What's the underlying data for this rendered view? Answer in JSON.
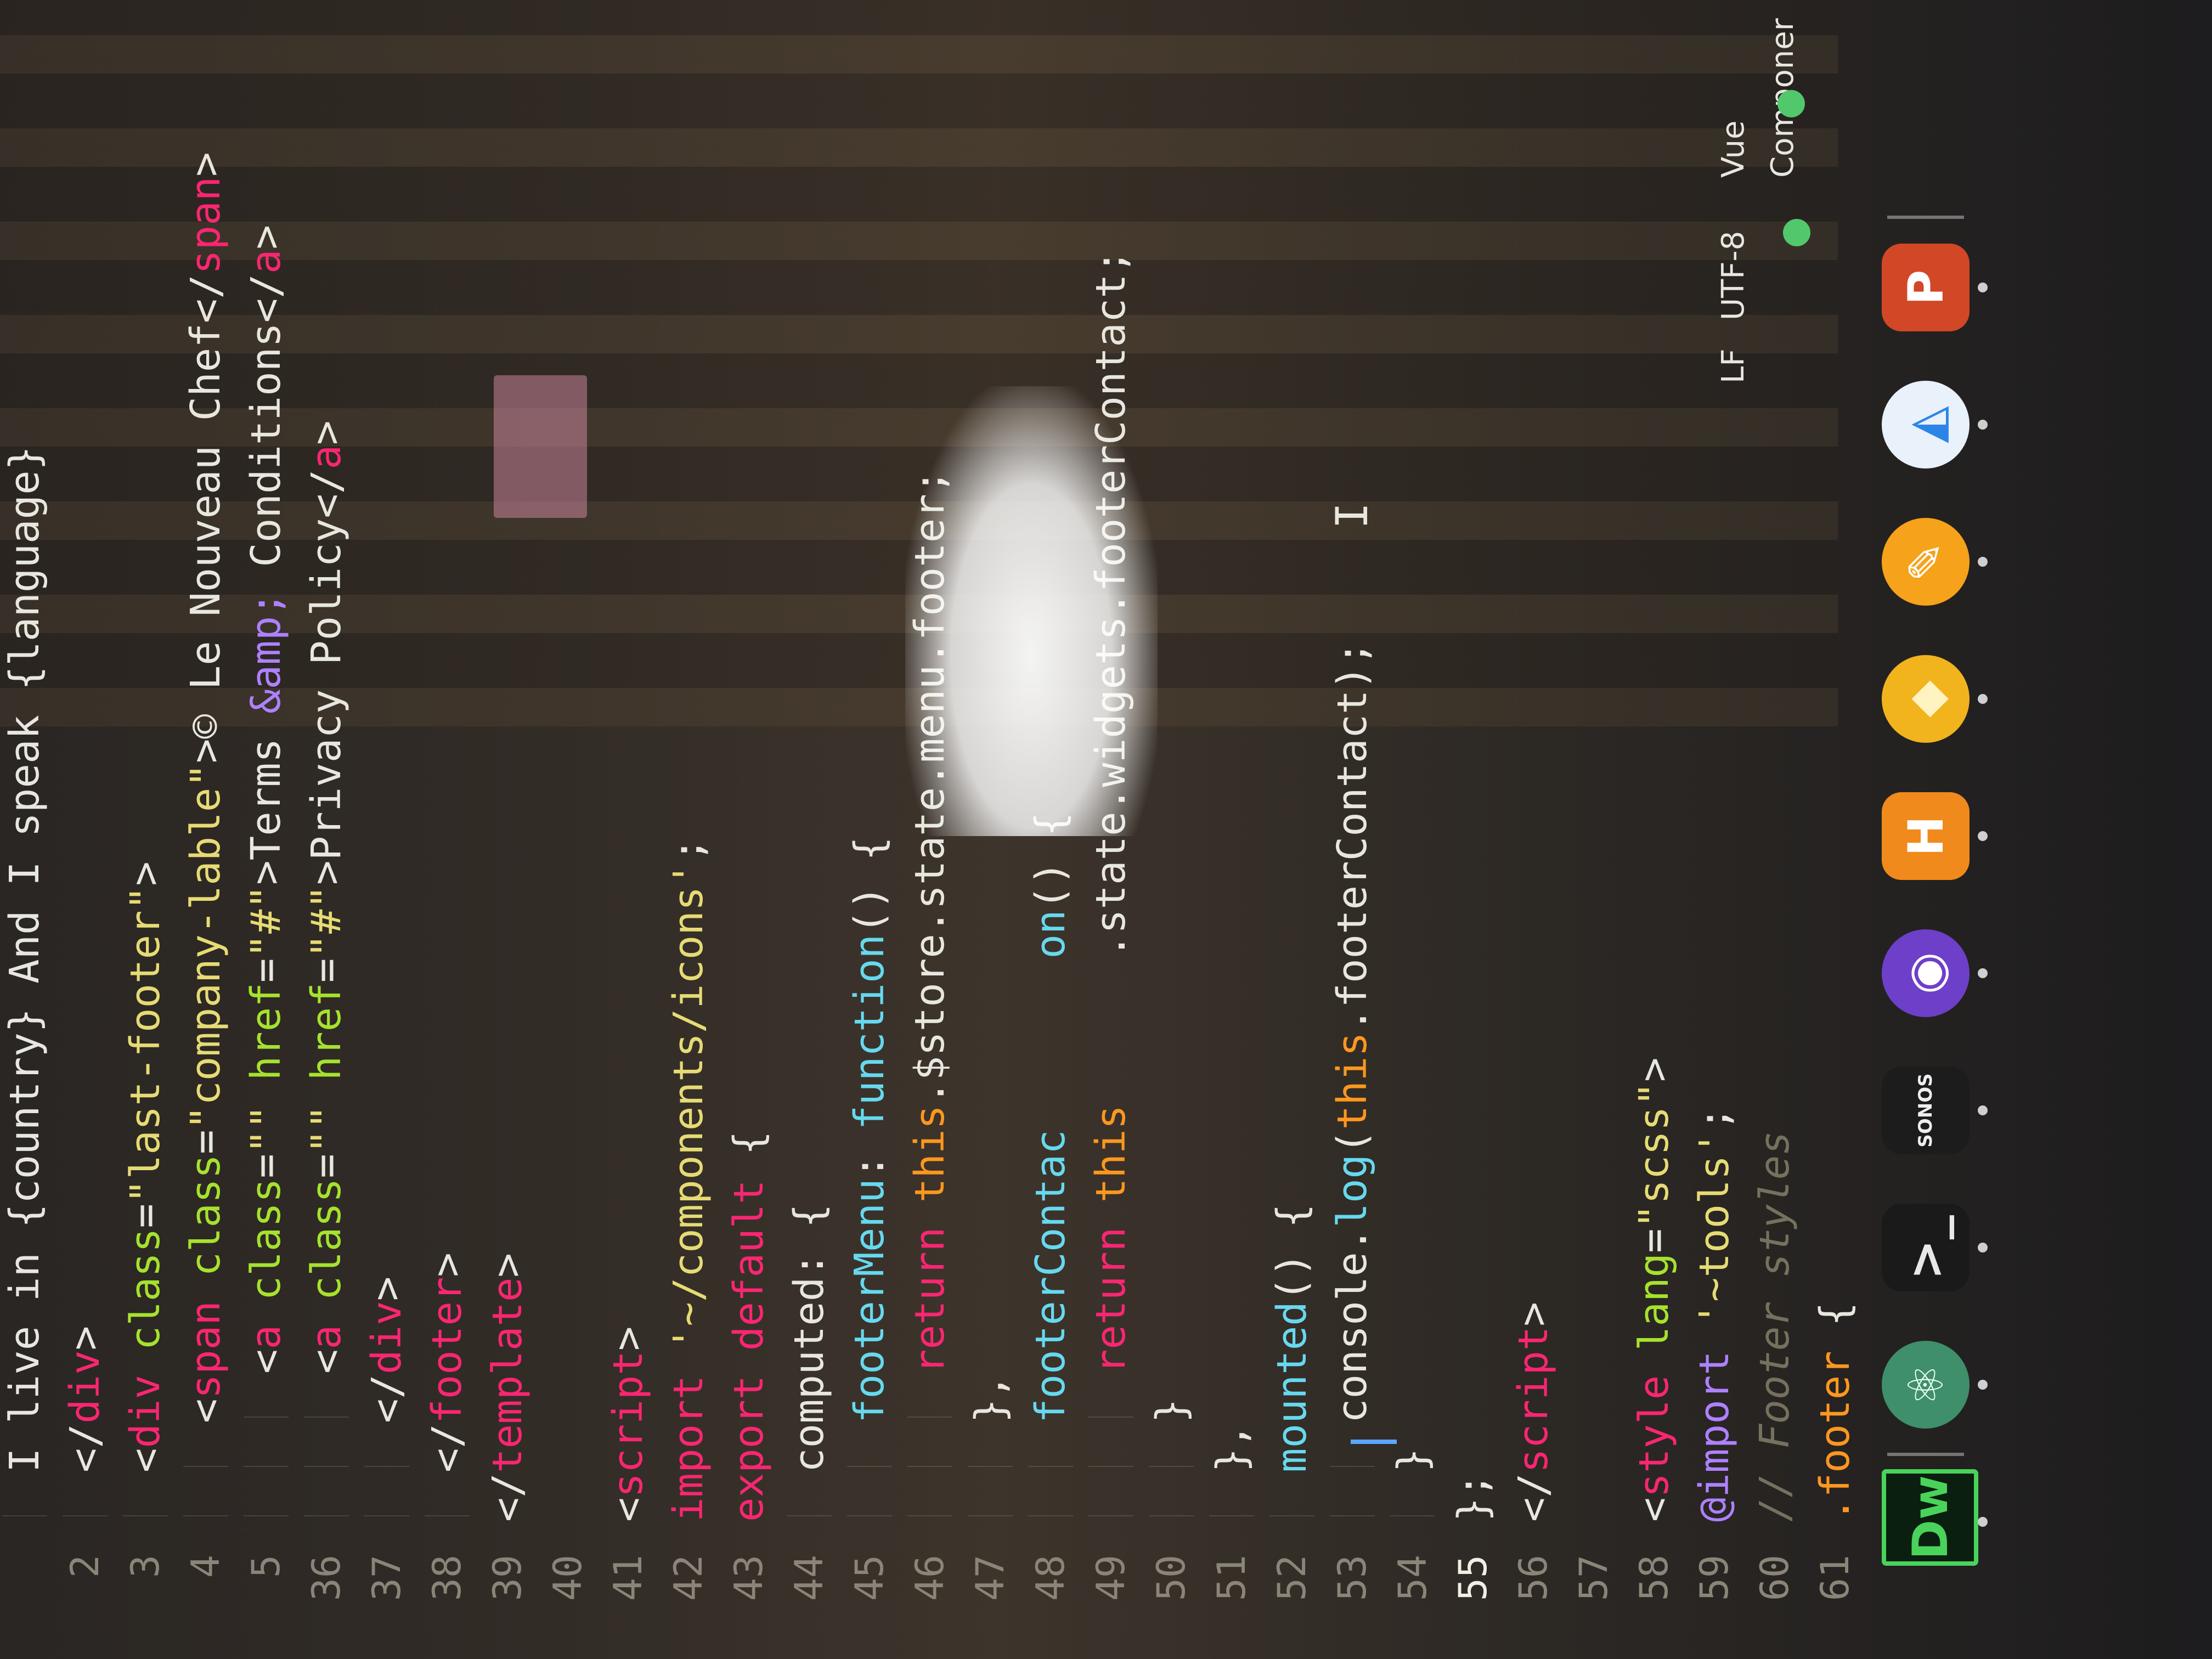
{
  "editor": {
    "lines": [
      {
        "n": "",
        "tokens": [
          {
            "t": "I live in {country} And I speak {language}",
            "c": "plain"
          }
        ]
      },
      {
        "n": "2",
        "tokens": [
          {
            "t": "</",
            "c": "punc"
          },
          {
            "t": "div",
            "c": "tag"
          },
          {
            "t": ">",
            "c": "punc"
          }
        ]
      },
      {
        "n": "3",
        "tokens": [
          {
            "t": "<",
            "c": "punc"
          },
          {
            "t": "div",
            "c": "tag"
          },
          {
            "t": " class",
            "c": "attr"
          },
          {
            "t": "=",
            "c": "punc"
          },
          {
            "t": "\"last-footer\"",
            "c": "str"
          },
          {
            "t": ">",
            "c": "punc"
          }
        ]
      },
      {
        "n": "4",
        "tokens": [
          {
            "t": "<",
            "c": "punc"
          },
          {
            "t": "span",
            "c": "tag"
          },
          {
            "t": " class",
            "c": "attr"
          },
          {
            "t": "=",
            "c": "punc"
          },
          {
            "t": "\"company-lable\"",
            "c": "str"
          },
          {
            "t": ">© Le Nouveau Chef</",
            "c": "plain"
          },
          {
            "t": "span",
            "c": "tag"
          },
          {
            "t": ">",
            "c": "punc"
          }
        ]
      },
      {
        "n": "5",
        "tokens": [
          {
            "t": "<",
            "c": "punc"
          },
          {
            "t": "a",
            "c": "tag"
          },
          {
            "t": " class",
            "c": "attr"
          },
          {
            "t": "=",
            "c": "punc"
          },
          {
            "t": "\"\"",
            "c": "str"
          },
          {
            "t": " href",
            "c": "attr"
          },
          {
            "t": "=",
            "c": "punc"
          },
          {
            "t": "\"#\"",
            "c": "str"
          },
          {
            "t": ">Terms ",
            "c": "plain"
          },
          {
            "t": "&amp;",
            "c": "at"
          },
          {
            "t": " Conditions</",
            "c": "plain"
          },
          {
            "t": "a",
            "c": "tag"
          },
          {
            "t": ">",
            "c": "punc"
          }
        ]
      },
      {
        "n": "36",
        "tokens": [
          {
            "t": "<",
            "c": "punc"
          },
          {
            "t": "a",
            "c": "tag"
          },
          {
            "t": " class",
            "c": "attr"
          },
          {
            "t": "=",
            "c": "punc"
          },
          {
            "t": "\"\"",
            "c": "str"
          },
          {
            "t": " href",
            "c": "attr"
          },
          {
            "t": "=",
            "c": "punc"
          },
          {
            "t": "\"#\"",
            "c": "str"
          },
          {
            "t": ">Privacy Policy</",
            "c": "plain"
          },
          {
            "t": "a",
            "c": "tag"
          },
          {
            "t": ">",
            "c": "punc"
          }
        ]
      },
      {
        "n": "37",
        "tokens": [
          {
            "t": "</",
            "c": "punc"
          },
          {
            "t": "div",
            "c": "tag"
          },
          {
            "t": ">",
            "c": "punc"
          }
        ]
      },
      {
        "n": "38",
        "tokens": [
          {
            "t": "</",
            "c": "punc"
          },
          {
            "t": "footer",
            "c": "tag"
          },
          {
            "t": ">",
            "c": "punc"
          }
        ]
      },
      {
        "n": "39",
        "tokens": [
          {
            "t": "</",
            "c": "punc"
          },
          {
            "t": "template",
            "c": "tag"
          },
          {
            "t": ">",
            "c": "punc"
          }
        ]
      },
      {
        "n": "40",
        "tokens": []
      },
      {
        "n": "41",
        "tokens": [
          {
            "t": "<",
            "c": "punc"
          },
          {
            "t": "script",
            "c": "tag"
          },
          {
            "t": ">",
            "c": "punc"
          }
        ]
      },
      {
        "n": "42",
        "tokens": [
          {
            "t": "import",
            "c": "kw"
          },
          {
            "t": " ",
            "c": "plain"
          },
          {
            "t": "'~/components/icons'",
            "c": "str"
          },
          {
            "t": ";",
            "c": "plain"
          }
        ]
      },
      {
        "n": "43",
        "tokens": [
          {
            "t": "export",
            "c": "kw"
          },
          {
            "t": " ",
            "c": "plain"
          },
          {
            "t": "default",
            "c": "kw"
          },
          {
            "t": " {",
            "c": "plain"
          }
        ]
      },
      {
        "n": "44",
        "tokens": [
          {
            "t": "computed: {",
            "c": "plain"
          }
        ]
      },
      {
        "n": "45",
        "tokens": [
          {
            "t": "footerMenu",
            "c": "fn"
          },
          {
            "t": ": ",
            "c": "plain"
          },
          {
            "t": "function",
            "c": "fn"
          },
          {
            "t": "() {",
            "c": "plain"
          }
        ]
      },
      {
        "n": "46",
        "tokens": [
          {
            "t": "return",
            "c": "kw"
          },
          {
            "t": " ",
            "c": "plain"
          },
          {
            "t": "this",
            "c": "this"
          },
          {
            "t": ".$store.state.menu.footer;",
            "c": "plain"
          }
        ]
      },
      {
        "n": "47",
        "tokens": [
          {
            "t": "},",
            "c": "plain"
          }
        ]
      },
      {
        "n": "48",
        "tokens": [
          {
            "t": "footerContac",
            "c": "fn"
          },
          {
            "t": "       ",
            "c": "plain"
          },
          {
            "t": "on",
            "c": "fn"
          },
          {
            "t": "() {",
            "c": "plain"
          }
        ]
      },
      {
        "n": "49",
        "tokens": [
          {
            "t": "return",
            "c": "kw"
          },
          {
            "t": " ",
            "c": "plain"
          },
          {
            "t": "this",
            "c": "this"
          },
          {
            "t": "      .state.widgets.footerContact;",
            "c": "plain"
          }
        ]
      },
      {
        "n": "50",
        "tokens": [
          {
            "t": "}",
            "c": "plain"
          }
        ]
      },
      {
        "n": "51",
        "tokens": [
          {
            "t": "},",
            "c": "plain"
          }
        ]
      },
      {
        "n": "52",
        "tokens": [
          {
            "t": "mounted",
            "c": "fn"
          },
          {
            "t": "() {",
            "c": "plain"
          }
        ]
      },
      {
        "n": "53",
        "tokens": [
          {
            "t": "console",
            "c": "plain"
          },
          {
            "t": ".",
            "c": "plain"
          },
          {
            "t": "log",
            "c": "fn"
          },
          {
            "t": "(",
            "c": "plain"
          },
          {
            "t": "this",
            "c": "this"
          },
          {
            "t": ".footerContact);",
            "c": "plain"
          }
        ]
      },
      {
        "n": "54",
        "tokens": [
          {
            "t": "}",
            "c": "plain"
          }
        ]
      },
      {
        "n": "55",
        "tokens": [
          {
            "t": "};",
            "c": "plain"
          }
        ],
        "active": true
      },
      {
        "n": "56",
        "tokens": [
          {
            "t": "</",
            "c": "punc"
          },
          {
            "t": "script",
            "c": "tag"
          },
          {
            "t": ">",
            "c": "punc"
          }
        ]
      },
      {
        "n": "57",
        "tokens": []
      },
      {
        "n": "58",
        "tokens": [
          {
            "t": "<",
            "c": "punc"
          },
          {
            "t": "style",
            "c": "tag"
          },
          {
            "t": " lang",
            "c": "attr"
          },
          {
            "t": "=",
            "c": "punc"
          },
          {
            "t": "\"scss\"",
            "c": "str"
          },
          {
            "t": ">",
            "c": "punc"
          }
        ]
      },
      {
        "n": "59",
        "tokens": [
          {
            "t": "@import",
            "c": "at"
          },
          {
            "t": " ",
            "c": "plain"
          },
          {
            "t": "'~tools'",
            "c": "str"
          },
          {
            "t": ";",
            "c": "plain"
          }
        ]
      },
      {
        "n": "60",
        "tokens": [
          {
            "t": "// Footer styles",
            "c": "com"
          }
        ]
      },
      {
        "n": "61",
        "tokens": [
          {
            "t": ".footer",
            "c": "prop"
          },
          {
            "t": " {",
            "c": "plain"
          }
        ]
      }
    ],
    "indents": [
      1,
      1,
      1,
      2,
      3,
      3,
      2,
      1,
      0,
      0,
      0,
      0,
      0,
      1,
      2,
      3,
      2,
      2,
      3,
      2,
      1,
      1,
      2,
      1,
      0,
      0,
      0,
      0,
      0,
      0,
      0
    ]
  },
  "statusbar": {
    "line_ending": "LF",
    "encoding": "UTF-8",
    "grammar": "Vue Componer"
  },
  "dock": {
    "apps": [
      {
        "name": "dreamweaver",
        "label": "Dw",
        "bg": "#0a1f0f",
        "fg": "#49d35a"
      },
      {
        "name": "atom",
        "label": "⚛",
        "bg": "#3f8f6a",
        "fg": "#e8fff2"
      },
      {
        "name": "terminal",
        "label": ">_",
        "bg": "#1a1a1a",
        "fg": "#e8e8e8"
      },
      {
        "name": "sonos",
        "label": "SONOS",
        "bg": "#1c1c1c",
        "fg": "#eeeeee"
      },
      {
        "name": "github-desktop",
        "label": "◉",
        "bg": "#6e3fc8",
        "fg": "#ffffff"
      },
      {
        "name": "hype",
        "label": "H",
        "bg": "#f08a1c",
        "fg": "#ffffff"
      },
      {
        "name": "sketch",
        "label": "◆",
        "bg": "#f2b41d",
        "fg": "#fff3c2"
      },
      {
        "name": "pencil-app",
        "label": "✎",
        "bg": "#f6a21a",
        "fg": "#ffffff"
      },
      {
        "name": "prism",
        "label": "◭",
        "bg": "#e9f1fb",
        "fg": "#2d84e8"
      },
      {
        "name": "powerpoint",
        "label": "P",
        "bg": "#d24726",
        "fg": "#ffffff"
      }
    ],
    "colors": {
      "indicator": "#cfcfcf"
    }
  },
  "colors": {
    "accent": "#5aa7ff",
    "status_ok": "#52c76c"
  }
}
